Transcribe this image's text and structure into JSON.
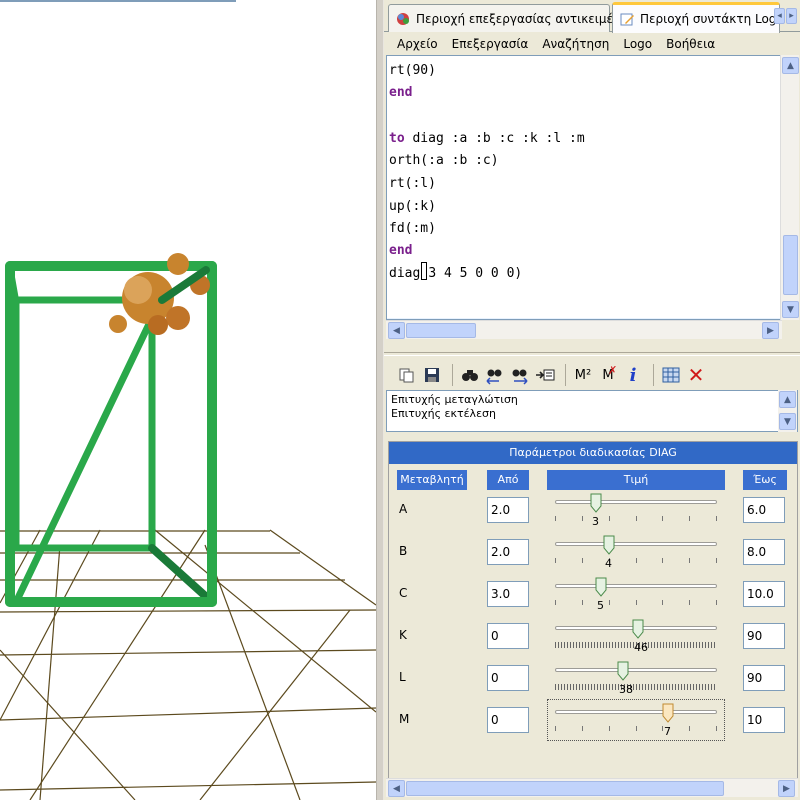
{
  "tabs": [
    {
      "label": "Περιοχή επεξεργασίας αντικειμένων",
      "icon": "objects-area-icon",
      "active": false
    },
    {
      "label": "Περιοχή συντάκτη Logo",
      "icon": "logo-editor-icon",
      "active": true
    }
  ],
  "menu": [
    "Αρχείο",
    "Επεξεργασία",
    "Αναζήτηση",
    "Logo",
    "Βοήθεια"
  ],
  "editor": {
    "lines": [
      {
        "text": "rt(90)",
        "keyword": false
      },
      {
        "text": "end",
        "keyword": true
      },
      {
        "text": "",
        "keyword": false
      },
      {
        "text": "orth(:a :b :c)",
        "keyword": false
      },
      {
        "text": "rt(:l)",
        "keyword": false
      },
      {
        "text": "up(:k)",
        "keyword": false
      },
      {
        "text": "fd(:m)",
        "keyword": false
      },
      {
        "text": "end",
        "keyword": true
      }
    ],
    "to_keyword": "to",
    "to_rest": " diag :a :b :c :k :l :m",
    "call_before_caret": "diag",
    "call_after_caret": "3 4 5 0 0 0)"
  },
  "toolbar": [
    "copy-icon",
    "save-icon",
    "find-icon",
    "find-previous-icon",
    "find-next-icon",
    "goto-line-icon",
    "m-squared-icon",
    "m-clear-icon",
    "info-icon",
    "grid-icon",
    "close-icon"
  ],
  "toolbar_text": {
    "m_squared": "M²",
    "m_clear": "M",
    "info": "i",
    "close": "✕"
  },
  "output": {
    "lines": [
      "Επιτυχής μεταγλώτιση",
      "Επιτυχής εκτέλεση"
    ]
  },
  "params": {
    "title": "Παράμετροι διαδικασίας DIAG",
    "headers": {
      "variable": "Μεταβλητή",
      "from": "Από",
      "value": "Τιμή",
      "to": "Έως"
    },
    "rows": [
      {
        "name": "A",
        "from": "2.0",
        "value": "3",
        "to": "6.0",
        "position": 0.25,
        "dense": false
      },
      {
        "name": "B",
        "from": "2.0",
        "value": "4",
        "to": "8.0",
        "position": 0.333,
        "dense": false
      },
      {
        "name": "C",
        "from": "3.0",
        "value": "5",
        "to": "10.0",
        "position": 0.286,
        "dense": false
      },
      {
        "name": "K",
        "from": "0",
        "value": "46",
        "to": "90",
        "position": 0.511,
        "dense": true
      },
      {
        "name": "L",
        "from": "0",
        "value": "38",
        "to": "90",
        "position": 0.422,
        "dense": true
      },
      {
        "name": "M",
        "from": "0",
        "value": "7",
        "to": "10",
        "position": 0.7,
        "dense": false
      }
    ]
  },
  "colors": {
    "accent": "#3169c6",
    "box": "#2aa84a",
    "turtle": "#c87a2a",
    "grid": "#5c4a1e",
    "keyword": "#7a1f8c"
  }
}
